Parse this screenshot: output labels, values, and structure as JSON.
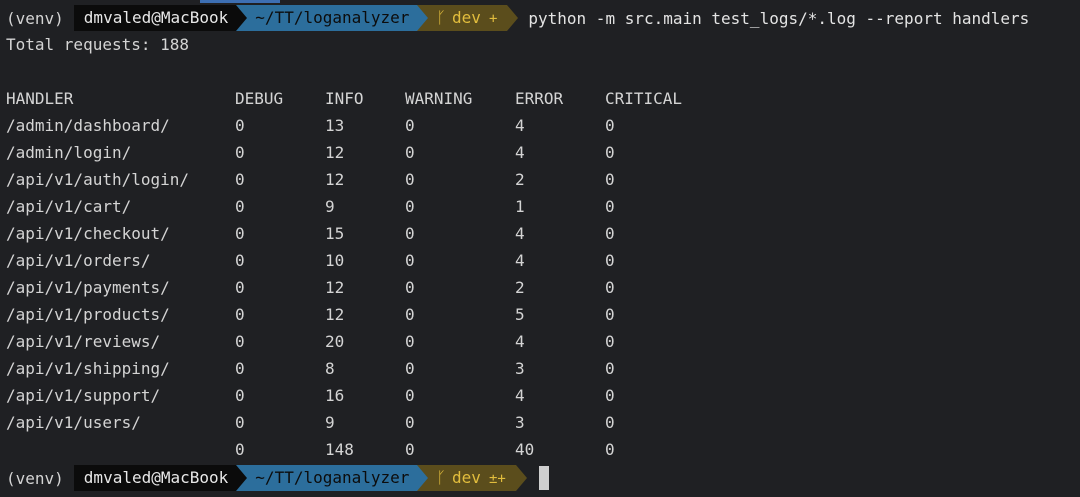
{
  "prompt": {
    "venv": "(venv)",
    "user_host": "dmvaled@MacBook",
    "path": "~/TT/loganalyzer",
    "branch_icon": "git-branch-icon",
    "branch": "dev",
    "status_first": "+",
    "status_second": "±+"
  },
  "command": "python -m src.main test_logs/*.log --report handlers",
  "total_line": "Total requests: 188",
  "table": {
    "headers": [
      "HANDLER",
      "DEBUG",
      "INFO",
      "WARNING",
      "ERROR",
      "CRITICAL"
    ],
    "rows": [
      [
        "/admin/dashboard/",
        "0",
        "13",
        "0",
        "4",
        "0"
      ],
      [
        "/admin/login/",
        "0",
        "12",
        "0",
        "4",
        "0"
      ],
      [
        "/api/v1/auth/login/",
        "0",
        "12",
        "0",
        "2",
        "0"
      ],
      [
        "/api/v1/cart/",
        "0",
        "9",
        "0",
        "1",
        "0"
      ],
      [
        "/api/v1/checkout/",
        "0",
        "15",
        "0",
        "4",
        "0"
      ],
      [
        "/api/v1/orders/",
        "0",
        "10",
        "0",
        "4",
        "0"
      ],
      [
        "/api/v1/payments/",
        "0",
        "12",
        "0",
        "2",
        "0"
      ],
      [
        "/api/v1/products/",
        "0",
        "12",
        "0",
        "5",
        "0"
      ],
      [
        "/api/v1/reviews/",
        "0",
        "20",
        "0",
        "4",
        "0"
      ],
      [
        "/api/v1/shipping/",
        "0",
        "8",
        "0",
        "3",
        "0"
      ],
      [
        "/api/v1/support/",
        "0",
        "16",
        "0",
        "4",
        "0"
      ],
      [
        "/api/v1/users/",
        "0",
        "9",
        "0",
        "3",
        "0"
      ]
    ],
    "totals": [
      "",
      "0",
      "148",
      "0",
      "40",
      "0"
    ]
  },
  "colors": {
    "background": "#1f2023",
    "text": "#d4d4d4",
    "user_segment": "#0b0b0b",
    "path_segment": "#2c6e9c",
    "git_segment": "#5b4d1c",
    "git_text": "#e2bd3d"
  }
}
